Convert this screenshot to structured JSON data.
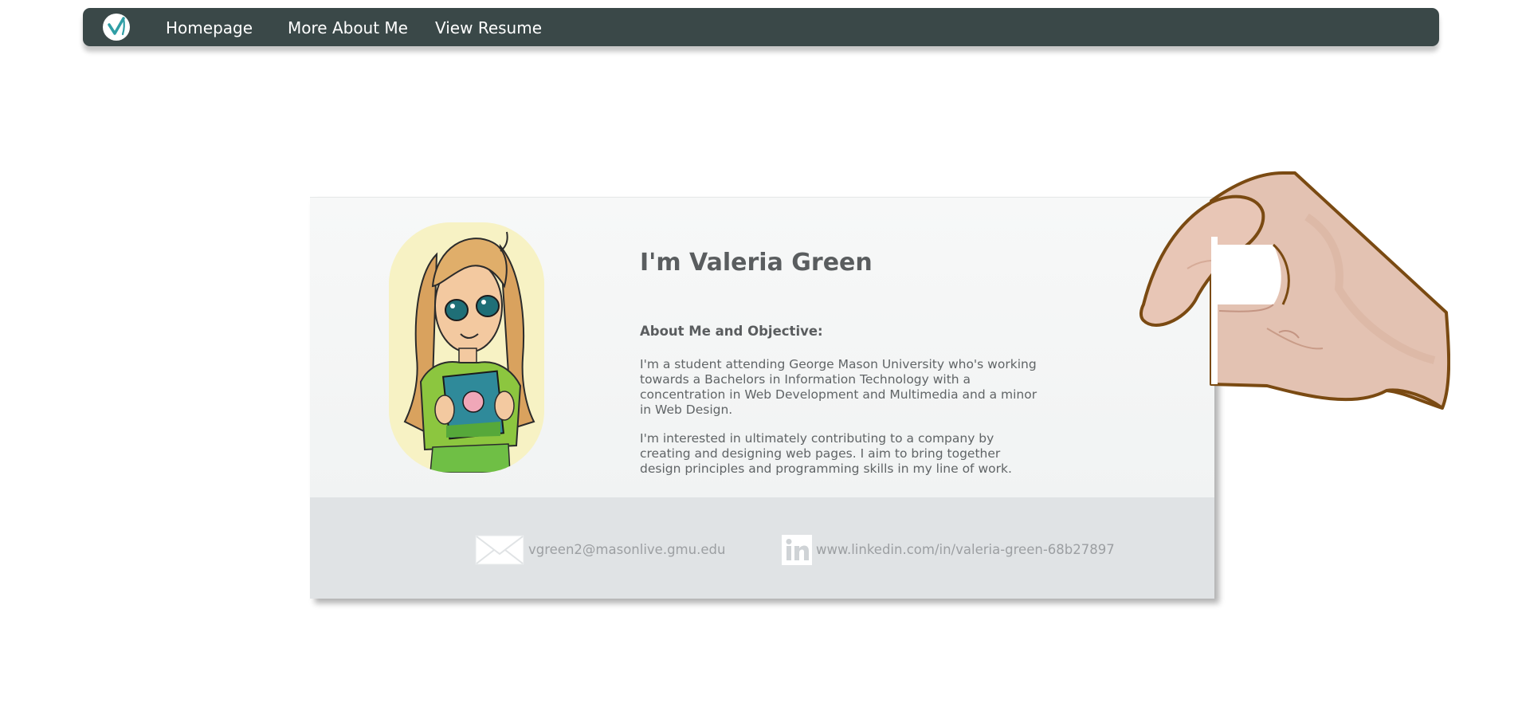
{
  "nav": {
    "logo_icon": "v-checkmark-logo-icon",
    "links": [
      {
        "label": "Homepage"
      },
      {
        "label": "More About Me"
      },
      {
        "label": "View Resume"
      }
    ]
  },
  "card": {
    "avatar_icon": "cartoon-portrait-drawing",
    "title": "I'm Valeria Green",
    "section_heading": "About Me and Objective:",
    "paragraphs": [
      "I'm a student attending George Mason University who's working towards a Bachelors in Information Technology with a concentration in Web Development and Multimedia and a minor in Web Design.",
      "I'm interested in ultimately contributing to a company by creating and designing web pages. I aim to bring together design principles and programming skills in my line of work."
    ],
    "contacts": {
      "email": {
        "icon": "envelope-icon",
        "text": "vgreen2@masonlive.gmu.edu"
      },
      "linkedin": {
        "icon": "linkedin-icon",
        "text": "www.linkedin.com/in/valeria-green-68b27897"
      }
    }
  },
  "decoration": {
    "hand_icon": "hand-holding-card-illustration"
  },
  "colors": {
    "navbar": "#3a4848",
    "logo_accent": "#2f9ea5",
    "card_footer": "#e0e3e5",
    "heading_text": "#5a5d5f",
    "contact_text": "#9c9fa2",
    "hand_outline": "#7a4a12",
    "hand_skin": "#e3c2b2"
  }
}
